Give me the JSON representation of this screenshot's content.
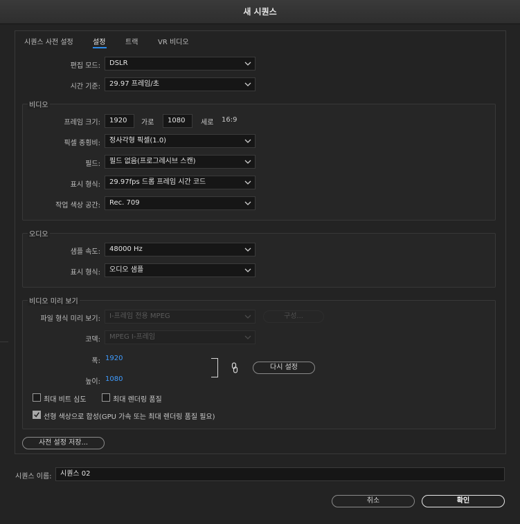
{
  "window": {
    "title": "새 시퀀스"
  },
  "tabs": [
    {
      "label": "시퀀스 사전 설정",
      "active": false
    },
    {
      "label": "설정",
      "active": true
    },
    {
      "label": "트랙",
      "active": false
    },
    {
      "label": "VR 비디오",
      "active": false
    }
  ],
  "general": {
    "editing_mode": {
      "label": "편집 모드:",
      "value": "DSLR"
    },
    "timebase": {
      "label": "시간 기준:",
      "value": "29.97  프레임/초"
    }
  },
  "video": {
    "title": "비디오",
    "frame_size": {
      "label": "프레임 크기:",
      "width": "1920",
      "horizontal_label": "가로",
      "height": "1080",
      "vertical_label": "세로",
      "aspect": "16:9"
    },
    "pixel_aspect": {
      "label": "픽셀 종횡비:",
      "value": "정사각형 픽셀(1.0)"
    },
    "fields": {
      "label": "필드:",
      "value": "필드 없음(프로그레시브 스캔)"
    },
    "display_format": {
      "label": "표시 형식:",
      "value": "29.97fps 드롭 프레임 시간 코드"
    },
    "working_color_space": {
      "label": "작업 색상 공간:",
      "value": "Rec. 709"
    }
  },
  "audio": {
    "title": "오디오",
    "sample_rate": {
      "label": "샘플 속도:",
      "value": "48000 Hz"
    },
    "display_format": {
      "label": "표시 형식:",
      "value": "오디오 샘플"
    }
  },
  "video_preview": {
    "title": "비디오 미리 보기",
    "file_format": {
      "label": "파일 형식 미리 보기:",
      "value": "I-프레임 전용 MPEG",
      "configure_label": "구성..."
    },
    "codec": {
      "label": "코덱:",
      "value": "MPEG I-프레임"
    },
    "width": {
      "label": "폭:",
      "value": "1920"
    },
    "height": {
      "label": "높이:",
      "value": "1080"
    },
    "reset_label": "다시 설정",
    "max_bit_depth": {
      "label": "최대 비트 심도",
      "checked": false
    },
    "max_render_quality": {
      "label": "최대 렌더링 품질",
      "checked": false
    },
    "linear_color": {
      "label": "선형 색상으로 합성(GPU 가속 또는 최대 렌더링 품질 필요)",
      "checked": true
    }
  },
  "save_preset_label": "사전 설정 저장...",
  "sequence_name": {
    "label": "시퀀스 이름:",
    "value": "시퀀스 02"
  },
  "buttons": {
    "cancel": "취소",
    "ok": "확인"
  },
  "colors": {
    "accent": "#2d8ceb",
    "link_value": "#3f9cff",
    "background": "#232323"
  }
}
